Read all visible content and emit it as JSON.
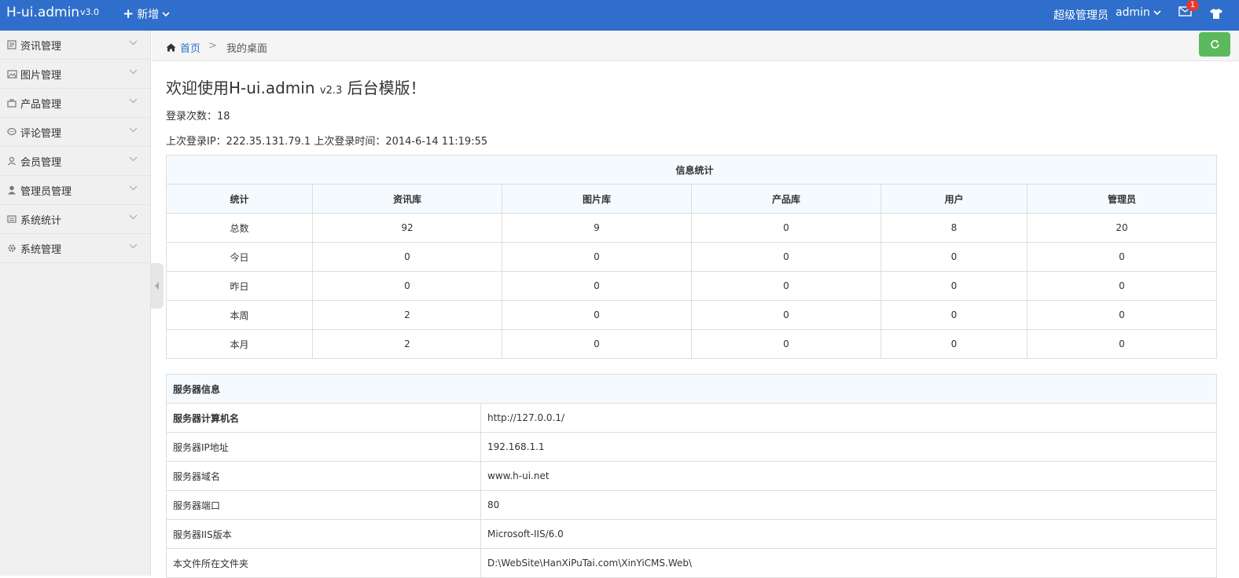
{
  "header": {
    "brand": "H-ui.admin",
    "brand_version": "v3.0",
    "new_label": "新增",
    "role": "超级管理员",
    "username": "admin",
    "message_count": "1"
  },
  "sidebar": {
    "items": [
      {
        "label": "资讯管理"
      },
      {
        "label": "图片管理"
      },
      {
        "label": "产品管理"
      },
      {
        "label": "评论管理"
      },
      {
        "label": "会员管理"
      },
      {
        "label": "管理员管理"
      },
      {
        "label": "系统统计"
      },
      {
        "label": "系统管理"
      }
    ]
  },
  "breadcrumb": {
    "home": "首页",
    "separator": ">",
    "current": "我的桌面"
  },
  "welcome": {
    "prefix": "欢迎使用H-ui.admin ",
    "version": "v2.3",
    "suffix": " 后台模版！"
  },
  "login_count": "登录次数：18",
  "last_login": "上次登录IP：222.35.131.79.1 上次登录时间：2014-6-14 11:19:55",
  "stats": {
    "title": "信息统计",
    "headers": [
      "统计",
      "资讯库",
      "图片库",
      "产品库",
      "用户",
      "管理员"
    ],
    "rows": [
      [
        "总数",
        "92",
        "9",
        "0",
        "8",
        "20"
      ],
      [
        "今日",
        "0",
        "0",
        "0",
        "0",
        "0"
      ],
      [
        "昨日",
        "0",
        "0",
        "0",
        "0",
        "0"
      ],
      [
        "本周",
        "2",
        "0",
        "0",
        "0",
        "0"
      ],
      [
        "本月",
        "2",
        "0",
        "0",
        "0",
        "0"
      ]
    ]
  },
  "server": {
    "title": "服务器信息",
    "rows": [
      [
        "服务器计算机名",
        "http://127.0.0.1/"
      ],
      [
        "服务器IP地址",
        "192.168.1.1"
      ],
      [
        "服务器域名",
        "www.h-ui.net"
      ],
      [
        "服务器端口",
        "80"
      ],
      [
        "服务器IIS版本",
        "Microsoft-IIS/6.0"
      ],
      [
        "本文件所在文件夹",
        "D:\\WebSite\\HanXiPuTai.com\\XinYiCMS.Web\\"
      ]
    ]
  },
  "colors": {
    "topbar": "#2f6ecb",
    "refresh": "#5cb85c",
    "badge": "#e03c31"
  }
}
